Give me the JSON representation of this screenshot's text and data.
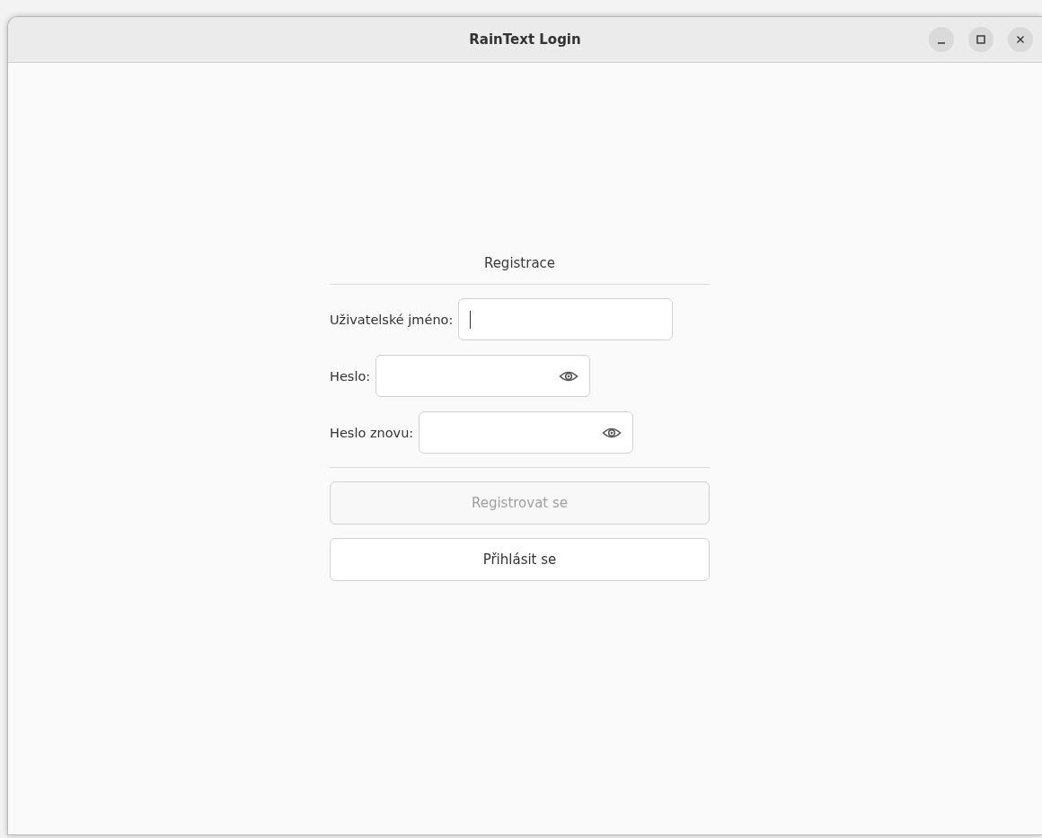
{
  "window": {
    "title": "RainText Login"
  },
  "form": {
    "heading": "Registrace",
    "fields": [
      {
        "label": "Uživatelské jméno:",
        "kind": "text",
        "focused": true
      },
      {
        "label": "Heslo:",
        "kind": "password",
        "focused": false
      },
      {
        "label": "Heslo znovu:",
        "kind": "password",
        "focused": false
      }
    ],
    "buttons": [
      {
        "label": "Registrovat se",
        "disabled": true
      },
      {
        "label": "Přihlásit se",
        "disabled": false
      }
    ]
  }
}
